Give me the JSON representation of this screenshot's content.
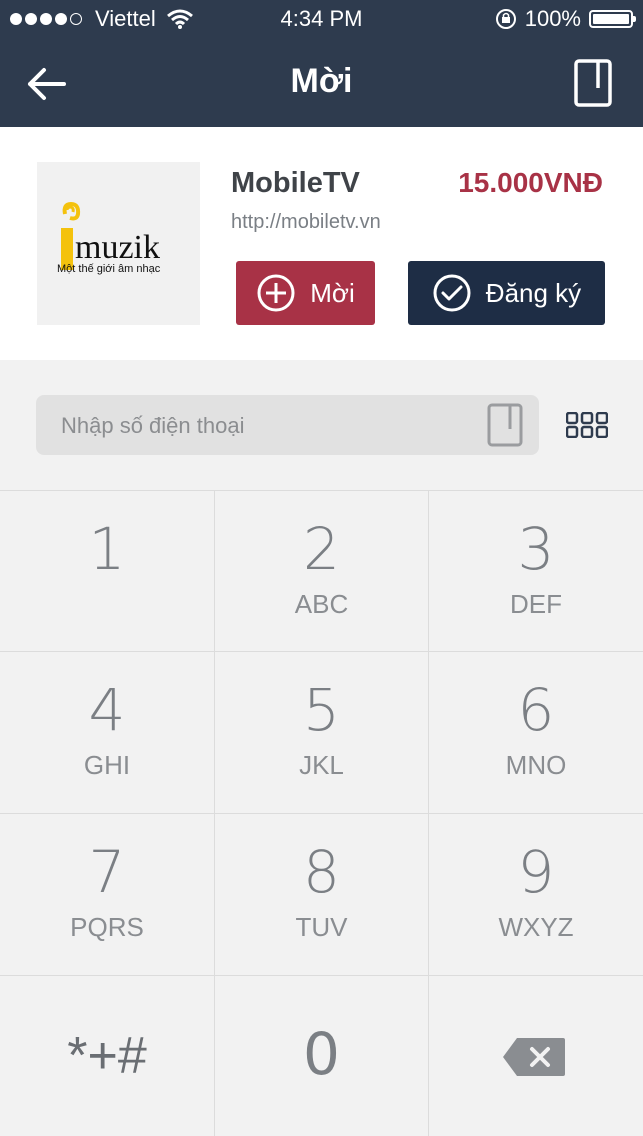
{
  "status_bar": {
    "carrier": "Viettel",
    "time": "4:34 PM",
    "battery": "100%"
  },
  "nav": {
    "title": "Mời"
  },
  "product": {
    "name": "MobileTV",
    "price": "15.000VNĐ",
    "url": "http://mobiletv.vn",
    "logo_text": "muzik",
    "logo_tagline": "Một thế giới âm nhạc",
    "invite_label": "Mời",
    "register_label": "Đăng ký"
  },
  "input": {
    "placeholder": "Nhập số điện thoại"
  },
  "keypad": {
    "keys": [
      {
        "digit": "1",
        "letters": ""
      },
      {
        "digit": "2",
        "letters": "ABC"
      },
      {
        "digit": "3",
        "letters": "DEF"
      },
      {
        "digit": "4",
        "letters": "GHI"
      },
      {
        "digit": "5",
        "letters": "JKL"
      },
      {
        "digit": "6",
        "letters": "MNO"
      },
      {
        "digit": "7",
        "letters": "PQRS"
      },
      {
        "digit": "8",
        "letters": "TUV"
      },
      {
        "digit": "9",
        "letters": "WXYZ"
      },
      {
        "digit": "*+#",
        "letters": ""
      },
      {
        "digit": "0",
        "letters": ""
      }
    ]
  },
  "colors": {
    "header": "#2e3b4e",
    "accent_red": "#a83246",
    "dark_navy": "#1e2d45",
    "logo_yellow": "#f4c20d"
  }
}
